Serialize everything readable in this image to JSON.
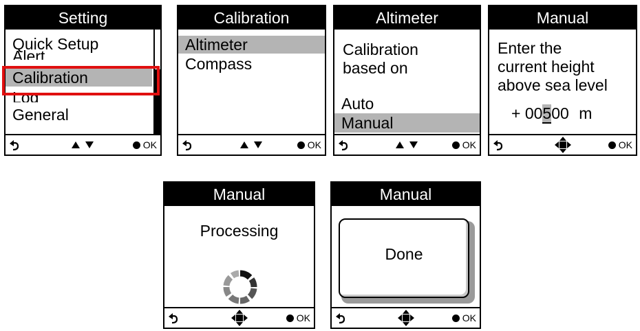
{
  "screens": {
    "setting": {
      "title": "Setting",
      "items": [
        "Quick Setup",
        "Alert",
        "Calibration",
        "Log",
        "General"
      ],
      "selected": "Calibration"
    },
    "calibration": {
      "title": "Calibration",
      "items": [
        "Altimeter",
        "Compass"
      ],
      "selected": "Altimeter"
    },
    "altimeter": {
      "title": "Altimeter",
      "prompt_line1": "Calibration",
      "prompt_line2": "based on",
      "options": [
        "Auto",
        "Manual"
      ],
      "selected": "Manual"
    },
    "manual_entry": {
      "title": "Manual",
      "prompt_line1": "Enter the",
      "prompt_line2": "current height",
      "prompt_line3": "above sea level",
      "sign": "+",
      "digits_before": "00",
      "digit_active": "5",
      "digits_after": "00",
      "unit": "m"
    },
    "processing": {
      "title": "Manual",
      "message": "Processing"
    },
    "done": {
      "title": "Manual",
      "message": "Done"
    }
  },
  "footer": {
    "ok_label": "OK"
  },
  "icons": {
    "back": "back-arrow-icon",
    "updown": "up-down-arrows-icon",
    "dpad": "four-way-arrow-icon",
    "ok": "filled-dot-icon",
    "spinner": "spinner-icon"
  },
  "colors": {
    "highlight": "#b4b4b4",
    "callout": "#e01010",
    "titlebar": "#000000"
  }
}
